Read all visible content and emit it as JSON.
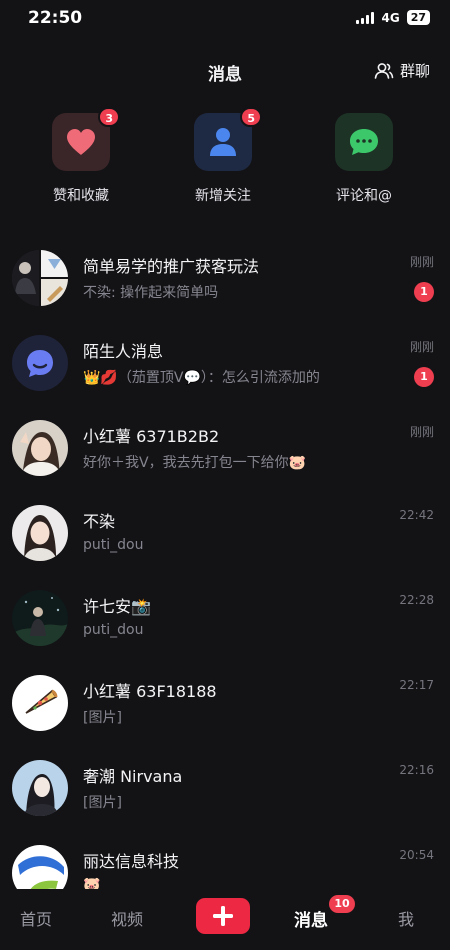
{
  "status_bar": {
    "time": "22:50",
    "network": "4G",
    "battery": "27"
  },
  "header": {
    "title": "消息",
    "group_chat_label": "群聊"
  },
  "shortcuts": [
    {
      "label": "赞和收藏",
      "badge": "3",
      "icon": "heart-icon",
      "color": "#f06b78"
    },
    {
      "label": "新增关注",
      "badge": "5",
      "icon": "person-icon",
      "color": "#4a86ee"
    },
    {
      "label": "评论和@",
      "badge": "",
      "icon": "chat-bubble-icon",
      "color": "#3cc86a"
    }
  ],
  "messages": [
    {
      "name": "简单易学的推广获客玩法",
      "preview": "不染: 操作起来简单吗",
      "time": "刚刚",
      "badge": "1",
      "avatar": "collage-avatar"
    },
    {
      "name": "陌生人消息",
      "preview": "👑💋（茄置顶V💬）：怎么引流添加的",
      "time": "刚刚",
      "badge": "1",
      "avatar": "chat-bubble-icon"
    },
    {
      "name": "小红薯 6371B2B2",
      "preview": "好你＋我V，我去先打包一下给你🐷",
      "time": "刚刚",
      "badge": "",
      "avatar": "photo-avatar"
    },
    {
      "name": "不染",
      "preview": "puti_dou",
      "time": "22:42",
      "badge": "",
      "avatar": "photo-avatar"
    },
    {
      "name": "许七安📸",
      "preview": "puti_dou",
      "time": "22:28",
      "badge": "",
      "avatar": "photo-avatar"
    },
    {
      "name": "小红薯 63F18188",
      "preview": "[图片]",
      "time": "22:17",
      "badge": "",
      "avatar": "pizza-avatar"
    },
    {
      "name": "奢潮 Nirvana",
      "preview": "[图片]",
      "time": "22:16",
      "badge": "",
      "avatar": "illustration-avatar"
    },
    {
      "name": "丽达信息科技",
      "preview": "🐷",
      "time": "20:54",
      "badge": "",
      "avatar": "logo-avatar"
    }
  ],
  "tab_bar": {
    "tabs": [
      "首页",
      "视频",
      "消息",
      "我"
    ],
    "active": "消息",
    "messages_badge": "10",
    "accent": "#ec2842"
  }
}
